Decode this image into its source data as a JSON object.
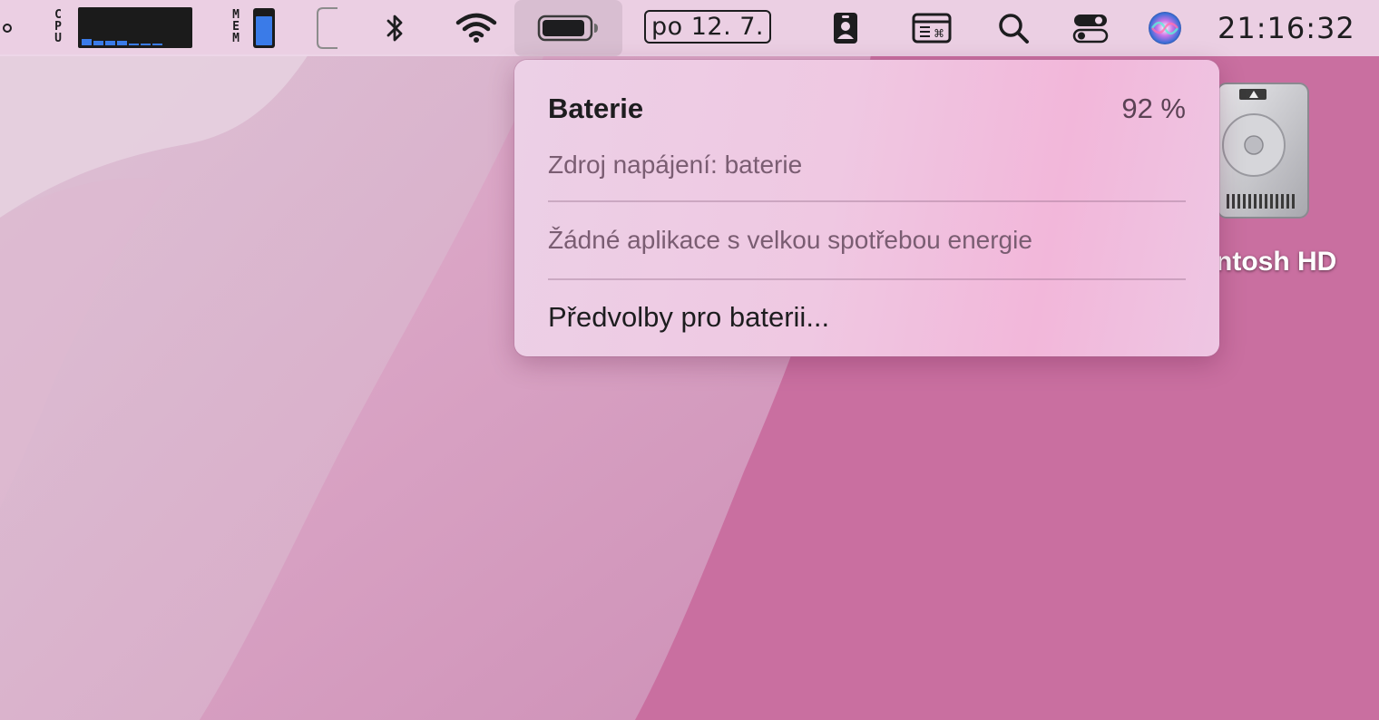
{
  "colors": {
    "menubar_bg": "#eed6e8",
    "popover_accent": "#f2b7da",
    "wallpaper_base": "#c96fa0",
    "graph_blue": "#3a7be8"
  },
  "menubar": {
    "cpu_label": "CPU",
    "cpu_graph_levels": [
      0.17,
      0.14,
      0.14,
      0.14,
      0.06,
      0.06,
      0.06
    ],
    "mem_label": "MEM",
    "mem_fill_fraction": 0.85,
    "battery_level_fraction": 0.92,
    "date": "po 12. 7.",
    "clock": "21:16:32",
    "icons": [
      "notch-edge-icon",
      "bluetooth-icon",
      "wifi-icon",
      "battery-icon",
      "contacts-card-icon",
      "keyboard-shortcut-icon",
      "search-icon",
      "control-center-icon",
      "siri-icon"
    ]
  },
  "battery_popover": {
    "title": "Baterie",
    "percent": "92 %",
    "power_source": "Zdroj napájení: baterie",
    "energy_apps": "Žádné aplikace s velkou spotřebou energie",
    "preferences": "Předvolby pro baterii..."
  },
  "desktop": {
    "disk_label": "ntosh HD",
    "disk_icon": "hard-drive-icon"
  }
}
